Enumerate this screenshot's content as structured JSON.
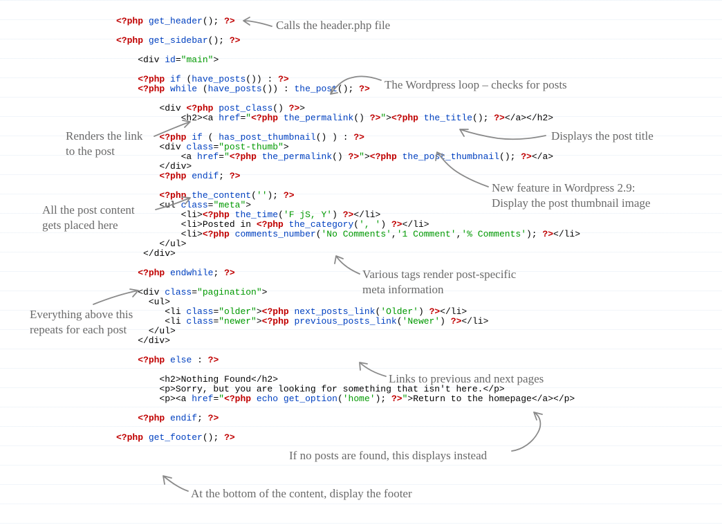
{
  "code_html": "<span class='r'>&lt;?php</span> <span class='b'>get_header</span>(); <span class='r'>?&gt;</span>\n\n<span class='r'>&lt;?php</span> <span class='b'>get_sidebar</span>(); <span class='r'>?&gt;</span>\n\n    &lt;div <span class='b'>id</span>=<span class='g'>\"main\"</span>&gt;\n\n    <span class='r'>&lt;?php</span> <span class='b'>if</span> (<span class='b'>have_posts</span>()) : <span class='r'>?&gt;</span>\n    <span class='r'>&lt;?php</span> <span class='b'>while</span> (<span class='b'>have_posts</span>()) : <span class='b'>the_post</span>(); <span class='r'>?&gt;</span>\n\n        &lt;div <span class='r'>&lt;?php</span> <span class='b'>post_class</span>() <span class='r'>?&gt;</span>&gt;\n            &lt;h2&gt;&lt;a <span class='b'>href</span>=<span class='g'>\"</span><span class='r'>&lt;?php</span> <span class='b'>the_permalink</span>() <span class='r'>?&gt;</span><span class='g'>\"</span>&gt;<span class='r'>&lt;?php</span> <span class='b'>the_title</span>(); <span class='r'>?&gt;</span>&lt;/a&gt;&lt;/h2&gt;\n\n        <span class='r'>&lt;?php</span> <span class='b'>if</span> ( <span class='b'>has_post_thumbnail</span>() ) : <span class='r'>?&gt;</span>\n        &lt;div <span class='b'>class</span>=<span class='g'>\"post-thumb\"</span>&gt;\n            &lt;a <span class='b'>href</span>=<span class='g'>\"</span><span class='r'>&lt;?php</span> <span class='b'>the_permalink</span>() <span class='r'>?&gt;</span><span class='g'>\"</span>&gt;<span class='r'>&lt;?php</span> <span class='b'>the_post_thumbnail</span>(); <span class='r'>?&gt;</span>&lt;/a&gt;\n        &lt;/div&gt;\n        <span class='r'>&lt;?php</span> <span class='b'>endif</span>; <span class='r'>?&gt;</span>\n\n        <span class='r'>&lt;?php</span> <span class='b'>the_content</span>(<span class='g'>''</span>); <span class='r'>?&gt;</span>\n        &lt;ul <span class='b'>class</span>=<span class='g'>\"meta\"</span>&gt;\n            &lt;li&gt;<span class='r'>&lt;?php</span> <span class='b'>the_time</span>(<span class='g'>'F jS, Y'</span>) <span class='r'>?&gt;</span>&lt;/li&gt;\n            &lt;li&gt;Posted in <span class='r'>&lt;?php</span> <span class='b'>the_category</span>(<span class='g'>', '</span>) <span class='r'>?&gt;</span>&lt;/li&gt;\n            &lt;li&gt;<span class='r'>&lt;?php</span> <span class='b'>comments_number</span>(<span class='g'>'No Comments'</span>,<span class='g'>'1 Comment'</span>,<span class='g'>'% Comments'</span>); <span class='r'>?&gt;</span>&lt;/li&gt;\n        &lt;/ul&gt;\n     &lt;/div&gt;\n\n    <span class='r'>&lt;?php</span> <span class='b'>endwhile</span>; <span class='r'>?&gt;</span>\n\n    &lt;div <span class='b'>class</span>=<span class='g'>\"pagination\"</span>&gt;\n      &lt;ul&gt;\n         &lt;li <span class='b'>class</span>=<span class='g'>\"older\"</span>&gt;<span class='r'>&lt;?php</span> <span class='b'>next_posts_link</span>(<span class='g'>'Older'</span>) <span class='r'>?&gt;</span>&lt;/li&gt;\n         &lt;li <span class='b'>class</span>=<span class='g'>\"newer\"</span>&gt;<span class='r'>&lt;?php</span> <span class='b'>previous_posts_link</span>(<span class='g'>'Newer'</span>) <span class='r'>?&gt;</span>&lt;/li&gt;\n      &lt;/ul&gt;\n    &lt;/div&gt;\n\n    <span class='r'>&lt;?php</span> <span class='b'>else</span> : <span class='r'>?&gt;</span>\n\n        &lt;h2&gt;Nothing Found&lt;/h2&gt;\n        &lt;p&gt;Sorry, but you are looking for something that isn't here.&lt;/p&gt;\n        &lt;p&gt;&lt;a <span class='b'>href</span>=<span class='g'>\"</span><span class='r'>&lt;?php</span> <span class='b'>echo</span> <span class='b'>get_option</span>(<span class='g'>'home'</span>); <span class='r'>?&gt;</span><span class='g'>\"</span>&gt;Return to the homepage&lt;/a&gt;&lt;/p&gt;\n\n    <span class='r'>&lt;?php</span> <span class='b'>endif</span>; <span class='r'>?&gt;</span>\n\n<span class='r'>&lt;?php</span> <span class='b'>get_footer</span>(); <span class='r'>?&gt;</span>",
  "annotations": {
    "header": "Calls the header.php file",
    "loop": "The Wordpress loop – checks for posts",
    "link": "Renders the link\nto the post",
    "title": "Displays the post title",
    "thumb": "New feature in Wordpress 2.9:\nDisplay the post thumbnail image",
    "content": "All the post content\ngets placed here",
    "meta": "Various tags render post-specific\nmeta information",
    "endwhile": "Everything above this\nrepeats for each post",
    "pagination": "Links to previous and next pages",
    "else": "If no posts are found, this displays instead",
    "footer": "At the bottom of the content, display the footer"
  }
}
